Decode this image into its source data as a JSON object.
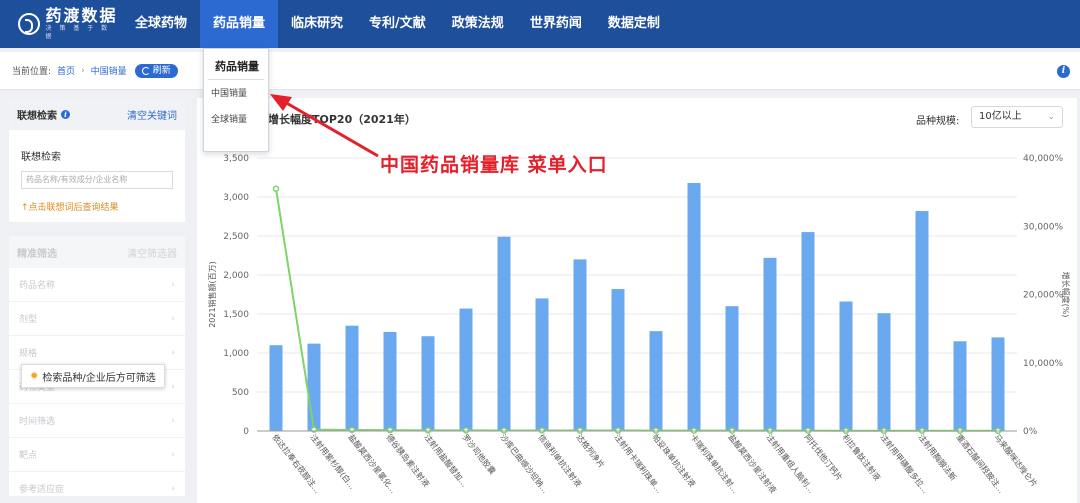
{
  "logo": {
    "title": "药渡数据",
    "subtitle": "决 策 基 于 数 据"
  },
  "nav": [
    "全球药物",
    "药品销量",
    "临床研究",
    "专利/文献",
    "政策法规",
    "世界药闻",
    "数据定制"
  ],
  "dropdown": {
    "header": "药品销量",
    "items": [
      "中国销量",
      "全球销量"
    ]
  },
  "breadcrumb": {
    "prefix": "当前位置:",
    "home": "首页",
    "current": "中国销量",
    "refresh": "刷新"
  },
  "sidebar": {
    "assoc_title": "联想检索",
    "assoc_clear": "清空关键词",
    "assoc_label": "联想检索",
    "assoc_placeholder": "药品名称/有效成分/企业名称",
    "assoc_tip": "↑点击联想词后查询结果",
    "filter_title": "精准筛选",
    "filter_clear": "清空筛选器",
    "filters": [
      "药品名称",
      "剂型",
      "规格",
      "药物类型",
      "时间筛选",
      "靶点",
      "参考适应症"
    ],
    "tooltip": "检索品种/企业后方可筛选"
  },
  "annotation": "中国药品销量库 菜单入口",
  "panel": {
    "scale_label": "品种规模:",
    "scale_value": "10亿以上"
  },
  "chart_data": {
    "type": "bar",
    "title": "增长幅度TOP20（2021年）",
    "ylabel": "2021销售额(百万)",
    "y2label": "增长幅度(%)",
    "ylim": [
      0,
      3500
    ],
    "y2lim": [
      0,
      40000
    ],
    "yticks": [
      "0",
      "500",
      "1,000",
      "1,500",
      "2,000",
      "2,500",
      "3,000",
      "3,500"
    ],
    "y2ticks": [
      "0%",
      "10,000%",
      "20,000%",
      "30,000%",
      "40,000%"
    ],
    "categories": [
      "依达拉奉右莰醇注…",
      "注射用紫杉醇(白…",
      "盐酸莫西沙星氯化…",
      "德谷胰岛素注射液",
      "注射用盐酸替加…",
      "罗沙司他胶囊",
      "沙库巴曲缬沙坦钠…",
      "信迪利单抗注射液",
      "达格列净片",
      "注射用卡瑞利珠单…",
      "帕妥珠单抗注射液",
      "卡瑞利珠单抗注射…",
      "盐酸莫西沙星注射液",
      "注射用重组人脑利…",
      "阿托伐他汀钙片",
      "利拉鲁肽注射液",
      "注射用甲磺酸多拉…",
      "注射用胸腺法新",
      "重酒石酸间羟胺注…",
      "马来酸咪达唑仑片"
    ],
    "grid": true,
    "series": [
      {
        "kind": "bar",
        "values": [
          1100,
          1120,
          1350,
          1270,
          1215,
          1570,
          2490,
          1700,
          2200,
          1820,
          1280,
          3180,
          1600,
          2220,
          2550,
          1660,
          1510,
          2820,
          1150,
          1200
        ]
      },
      {
        "kind": "line",
        "values": [
          35500,
          200,
          150,
          120,
          100,
          90,
          80,
          80,
          70,
          70,
          60,
          60,
          55,
          50,
          50,
          45,
          40,
          40,
          35,
          30
        ]
      }
    ],
    "colors": {
      "bar": "#6aa8f0",
      "line": "#7ed36a"
    }
  }
}
